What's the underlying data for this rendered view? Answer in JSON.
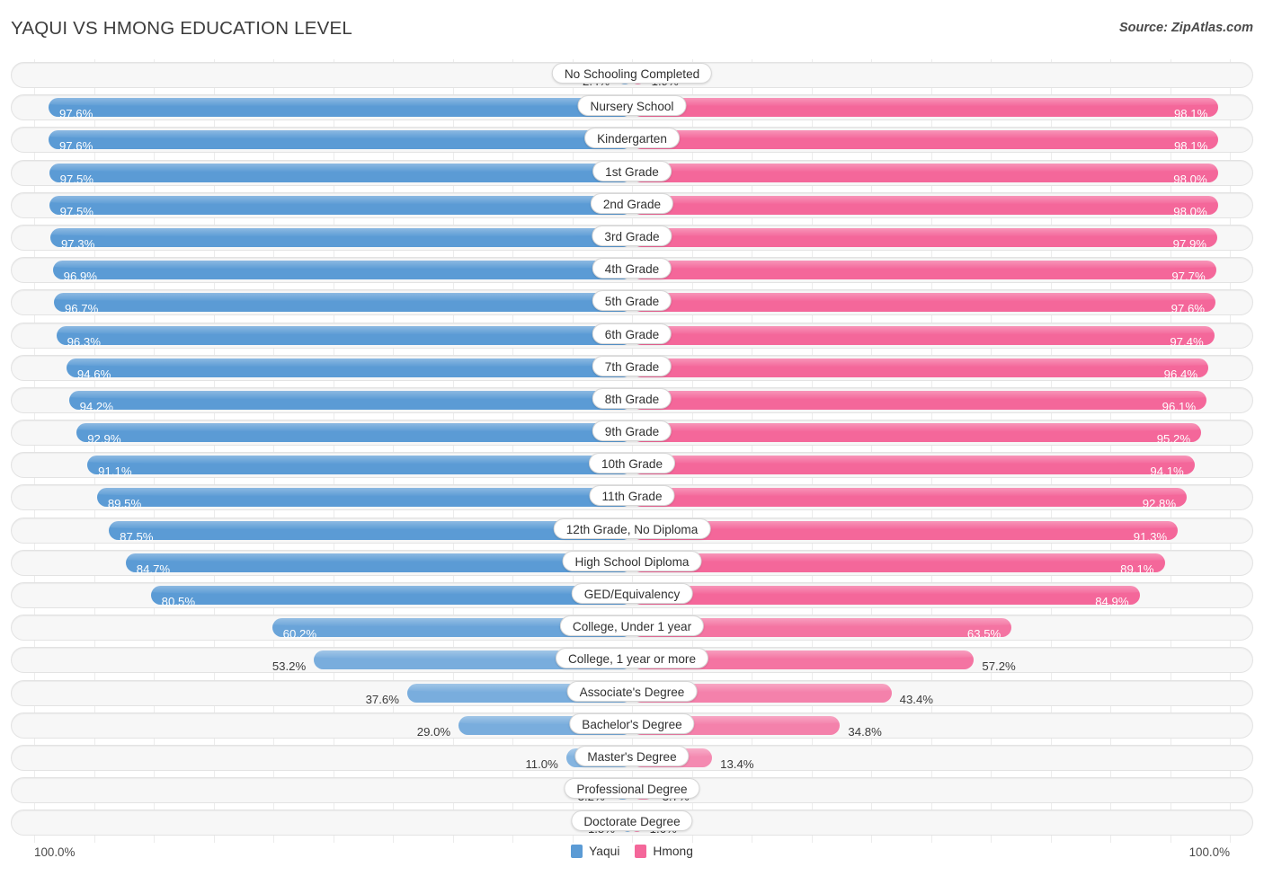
{
  "header": {
    "title": "YAQUI VS HMONG EDUCATION LEVEL",
    "source": "Source: ZipAtlas.com"
  },
  "footer": {
    "axis_left": "100.0%",
    "axis_right": "100.0%",
    "legend": [
      {
        "label": "Yaqui",
        "color": "#5b9bd5"
      },
      {
        "label": "Hmong",
        "color": "#f4679a"
      }
    ]
  },
  "colors": {
    "yaqui_strong": "#5b9bd5",
    "yaqui_light": "#9dc3e6",
    "hmong_strong": "#f4679a",
    "hmong_light": "#f4a0bf",
    "track": "#f7f7f7",
    "track_border": "#e3e3e3"
  },
  "chart_data": {
    "type": "bar",
    "title": "YAQUI VS HMONG EDUCATION LEVEL",
    "subtitle": "Source: ZipAtlas.com",
    "orientation": "horizontal-diverging",
    "xlabel": "",
    "ylabel": "",
    "xlim": [
      0,
      100
    ],
    "grid": true,
    "legend_position": "bottom-center",
    "axis_left_label": "100.0%",
    "axis_right_label": "100.0%",
    "categories": [
      "No Schooling Completed",
      "Nursery School",
      "Kindergarten",
      "1st Grade",
      "2nd Grade",
      "3rd Grade",
      "4th Grade",
      "5th Grade",
      "6th Grade",
      "7th Grade",
      "8th Grade",
      "9th Grade",
      "10th Grade",
      "11th Grade",
      "12th Grade, No Diploma",
      "High School Diploma",
      "GED/Equivalency",
      "College, Under 1 year",
      "College, 1 year or more",
      "Associate's Degree",
      "Bachelor's Degree",
      "Master's Degree",
      "Professional Degree",
      "Doctorate Degree"
    ],
    "series": [
      {
        "name": "Yaqui",
        "color": "#5b9bd5",
        "values": [
          2.4,
          97.6,
          97.6,
          97.5,
          97.5,
          97.3,
          96.9,
          96.7,
          96.3,
          94.6,
          94.2,
          92.9,
          91.1,
          89.5,
          87.5,
          84.7,
          80.5,
          60.2,
          53.2,
          37.6,
          29.0,
          11.0,
          3.2,
          1.5
        ],
        "labels": [
          "2.4%",
          "97.6%",
          "97.6%",
          "97.5%",
          "97.5%",
          "97.3%",
          "96.9%",
          "96.7%",
          "96.3%",
          "94.6%",
          "94.2%",
          "92.9%",
          "91.1%",
          "89.5%",
          "87.5%",
          "84.7%",
          "80.5%",
          "60.2%",
          "53.2%",
          "37.6%",
          "29.0%",
          "11.0%",
          "3.2%",
          "1.5%"
        ]
      },
      {
        "name": "Hmong",
        "color": "#f4679a",
        "values": [
          1.9,
          98.1,
          98.1,
          98.0,
          98.0,
          97.9,
          97.7,
          97.6,
          97.4,
          96.4,
          96.1,
          95.2,
          94.1,
          92.8,
          91.3,
          89.1,
          84.9,
          63.5,
          57.2,
          43.4,
          34.8,
          13.4,
          3.7,
          1.6
        ],
        "labels": [
          "1.9%",
          "98.1%",
          "98.1%",
          "98.0%",
          "98.0%",
          "97.9%",
          "97.7%",
          "97.6%",
          "97.4%",
          "96.4%",
          "96.1%",
          "95.2%",
          "94.1%",
          "92.8%",
          "91.3%",
          "89.1%",
          "84.9%",
          "63.5%",
          "57.2%",
          "43.4%",
          "34.8%",
          "13.4%",
          "3.7%",
          "1.6%"
        ]
      }
    ]
  }
}
